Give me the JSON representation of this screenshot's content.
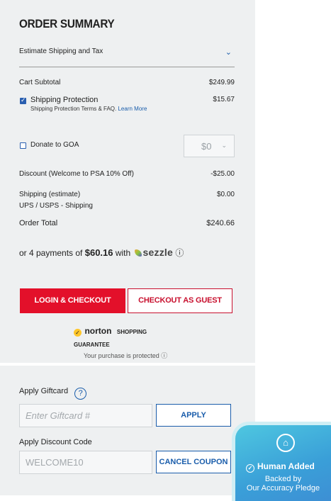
{
  "summary": {
    "title": "ORDER SUMMARY",
    "estimate_label": "Estimate Shipping and Tax",
    "cart_subtotal_label": "Cart Subtotal",
    "cart_subtotal_value": "$249.99",
    "shipping_protection_label": "Shipping Protection",
    "shipping_protection_checked": true,
    "shipping_protection_value": "$15.67",
    "shipping_protection_terms": "Shipping Protection Terms & FAQ.",
    "learn_more": "Learn More",
    "donate_label": "Donate to GOA",
    "donate_checked": false,
    "donate_amount": "$0",
    "discount_label": "Discount (Welcome to PSA 10% Off)",
    "discount_value": "-$25.00",
    "shipping_label": "Shipping (estimate)",
    "shipping_method": "UPS / USPS - Shipping",
    "shipping_value": "$0.00",
    "order_total_label": "Order Total",
    "order_total_value": "$240.66"
  },
  "sezzle": {
    "prefix": "or 4 payments of",
    "amount": "$60.16",
    "with": "with",
    "brand": "sezzle",
    "info": "ⓘ"
  },
  "buttons": {
    "login_checkout": "LOGIN & CHECKOUT",
    "guest_checkout": "CHECKOUT AS GUEST"
  },
  "norton": {
    "brand": "norton",
    "guarantee": "SHOPPING GUARANTEE",
    "sub": "Your purchase is protected ⓘ"
  },
  "giftcard": {
    "label": "Apply Giftcard",
    "help": "?",
    "placeholder": "Enter Giftcard #",
    "apply": "APPLY"
  },
  "discount_code": {
    "label": "Apply Discount Code",
    "value": "WELCOME10",
    "cancel": "CANCEL COUPON"
  },
  "badge": {
    "title": "Human Added",
    "line1": "Backed by",
    "line2": "Our Accuracy Pledge"
  },
  "colors": {
    "primary_red": "#e3102a",
    "link_blue": "#1a5dab",
    "panel_bg": "#eef0f1",
    "badge_cyan": "#4ec7e0"
  }
}
